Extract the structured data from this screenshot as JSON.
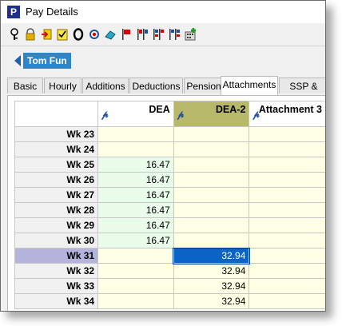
{
  "window": {
    "title": "Pay Details",
    "app_icon_letter": "P"
  },
  "toolbar": {
    "icons": [
      "key-icon",
      "lock-icon",
      "import-icon",
      "checklist-icon",
      "zero-icon",
      "target-icon",
      "eraser-icon",
      "flag-red-icon",
      "flag-pair-icon",
      "flags-multi-icon",
      "flags-blue-icon",
      "calculator-add-icon"
    ]
  },
  "employee": {
    "name": "Tom Fun"
  },
  "tabs": [
    {
      "label": "Basic"
    },
    {
      "label": "Hourly"
    },
    {
      "label": "Additions"
    },
    {
      "label": "Deductions"
    },
    {
      "label": "Pensions"
    },
    {
      "label": "Attachments"
    },
    {
      "label": "SSP & SMP"
    }
  ],
  "active_tab": "Attachments",
  "grid": {
    "columns": [
      {
        "label": "DEA"
      },
      {
        "label": "DEA-2"
      },
      {
        "label": "Attachment 3"
      }
    ],
    "rows": [
      {
        "week": "Wk 23",
        "dea": "",
        "dea2": "",
        "att3": ""
      },
      {
        "week": "Wk 24",
        "dea": "",
        "dea2": "",
        "att3": ""
      },
      {
        "week": "Wk 25",
        "dea": "16.47",
        "dea2": "",
        "att3": ""
      },
      {
        "week": "Wk 26",
        "dea": "16.47",
        "dea2": "",
        "att3": ""
      },
      {
        "week": "Wk 27",
        "dea": "16.47",
        "dea2": "",
        "att3": ""
      },
      {
        "week": "Wk 28",
        "dea": "16.47",
        "dea2": "",
        "att3": ""
      },
      {
        "week": "Wk 29",
        "dea": "16.47",
        "dea2": "",
        "att3": ""
      },
      {
        "week": "Wk 30",
        "dea": "16.47",
        "dea2": "",
        "att3": ""
      },
      {
        "week": "Wk 31",
        "dea": "",
        "dea2": "32.94",
        "att3": ""
      },
      {
        "week": "Wk 32",
        "dea": "",
        "dea2": "32.94",
        "att3": ""
      },
      {
        "week": "Wk 33",
        "dea": "",
        "dea2": "32.94",
        "att3": ""
      },
      {
        "week": "Wk 34",
        "dea": "",
        "dea2": "32.94",
        "att3": ""
      }
    ]
  },
  "colors": {
    "selected_column": "#b8b86a",
    "current_row_header": "#b3b3db",
    "active_cell": "#0a64c8",
    "green_cells": "#e9fbe9",
    "normal_cells": "#ffffe6"
  }
}
